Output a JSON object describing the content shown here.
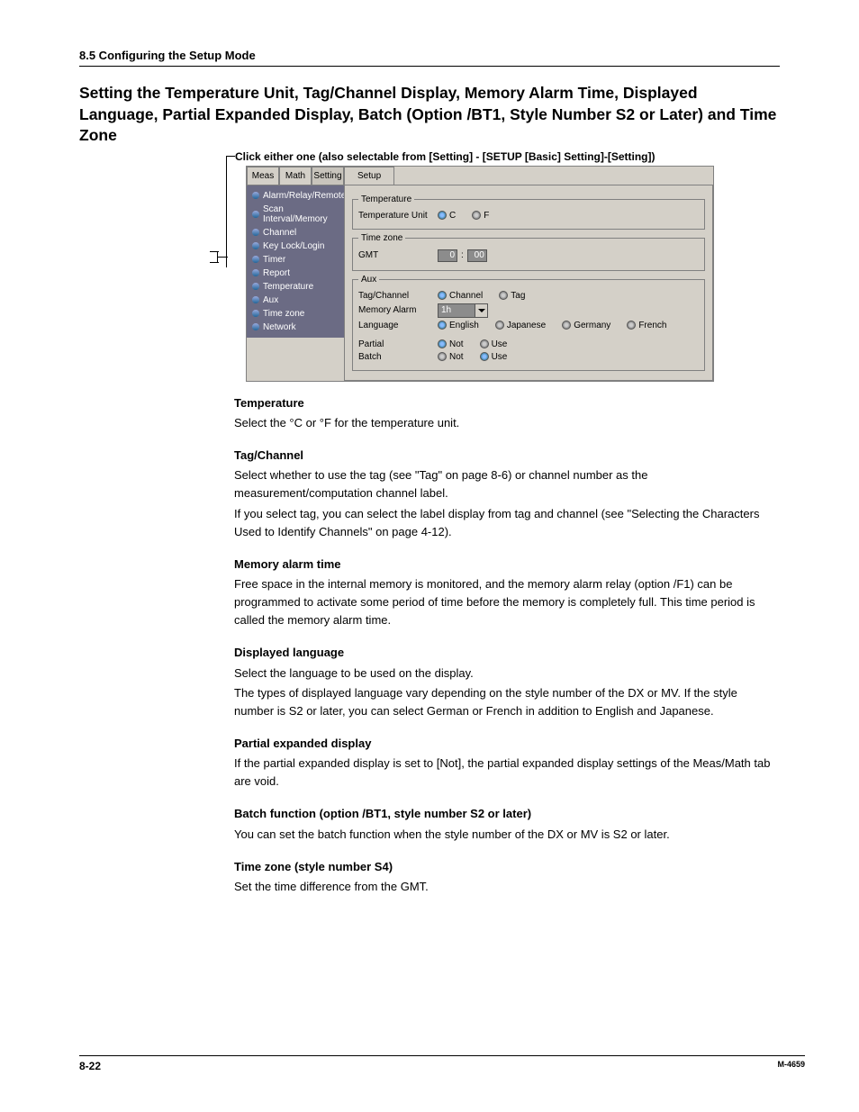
{
  "header": {
    "section": "8.5  Configuring the Setup Mode"
  },
  "title": "Setting the Temperature Unit, Tag/Channel Display, Memory Alarm Time, Displayed Language, Partial Expanded Display, Batch (Option /BT1, Style Number S2 or Later) and Time Zone",
  "hint": "Click either one (also selectable from [Setting] - [SETUP [Basic] Setting]-[Setting])",
  "app": {
    "top_tabs": [
      "Meas",
      "Math",
      "Setting"
    ],
    "setup_tab": "Setup",
    "sidemenu": [
      "Alarm/Relay/Remote",
      "Scan Interval/Memory",
      "Channel",
      "Key Lock/Login",
      "Timer",
      "Report",
      "Temperature",
      "Aux",
      "Time zone",
      "Network"
    ],
    "groups": {
      "temperature": {
        "legend": "Temperature",
        "label": "Temperature Unit",
        "opts": {
          "c": "C",
          "f": "F"
        }
      },
      "timezone": {
        "legend": "Time zone",
        "label": "GMT",
        "hour": "0",
        "min": "00"
      },
      "aux": {
        "legend": "Aux",
        "tagchannel": {
          "label": "Tag/Channel",
          "opt_channel": "Channel",
          "opt_tag": "Tag"
        },
        "memalarm": {
          "label": "Memory Alarm",
          "value": "1h"
        },
        "language": {
          "label": "Language",
          "en": "English",
          "jp": "Japanese",
          "de": "Germany",
          "fr": "French"
        },
        "partial": {
          "label": "Partial",
          "not": "Not",
          "use": "Use"
        },
        "batch": {
          "label": "Batch",
          "not": "Not",
          "use": "Use"
        }
      }
    }
  },
  "sections": {
    "temperature": {
      "h": "Temperature",
      "p1": "Select the °C or °F for the temperature unit."
    },
    "tagchannel": {
      "h": "Tag/Channel",
      "p1": "Select whether to use the tag (see \"Tag\" on page 8-6) or channel number as the measurement/computation channel label.",
      "p2": "If you select tag, you can select the label display from tag and channel (see \"Selecting the Characters Used to Identify Channels\" on page 4-12)."
    },
    "memalarm": {
      "h": "Memory alarm time",
      "p1": "Free space in the internal memory is monitored, and the memory alarm relay (option /F1) can be programmed to activate some period of time before the memory is completely full. This time period is called the memory alarm time."
    },
    "language": {
      "h": "Displayed language",
      "p1": "Select the language to be used on the display.",
      "p2": "The types of displayed language vary depending on the style number of the DX or MV.  If the style number is S2 or later, you can select German or French in addition to English and Japanese."
    },
    "partial": {
      "h": "Partial expanded display",
      "p1": "If the partial expanded display is set to [Not], the partial expanded display settings of the Meas/Math tab are void."
    },
    "batch": {
      "h": "Batch function (option /BT1, style number S2 or later)",
      "p1": "You can set the batch function when the style number of the DX or MV is  S2 or later."
    },
    "timezone": {
      "h": "Time zone (style number S4)",
      "p1": "Set the time difference from the GMT."
    }
  },
  "footer": {
    "page": "8-22",
    "doc": "M-4659"
  }
}
